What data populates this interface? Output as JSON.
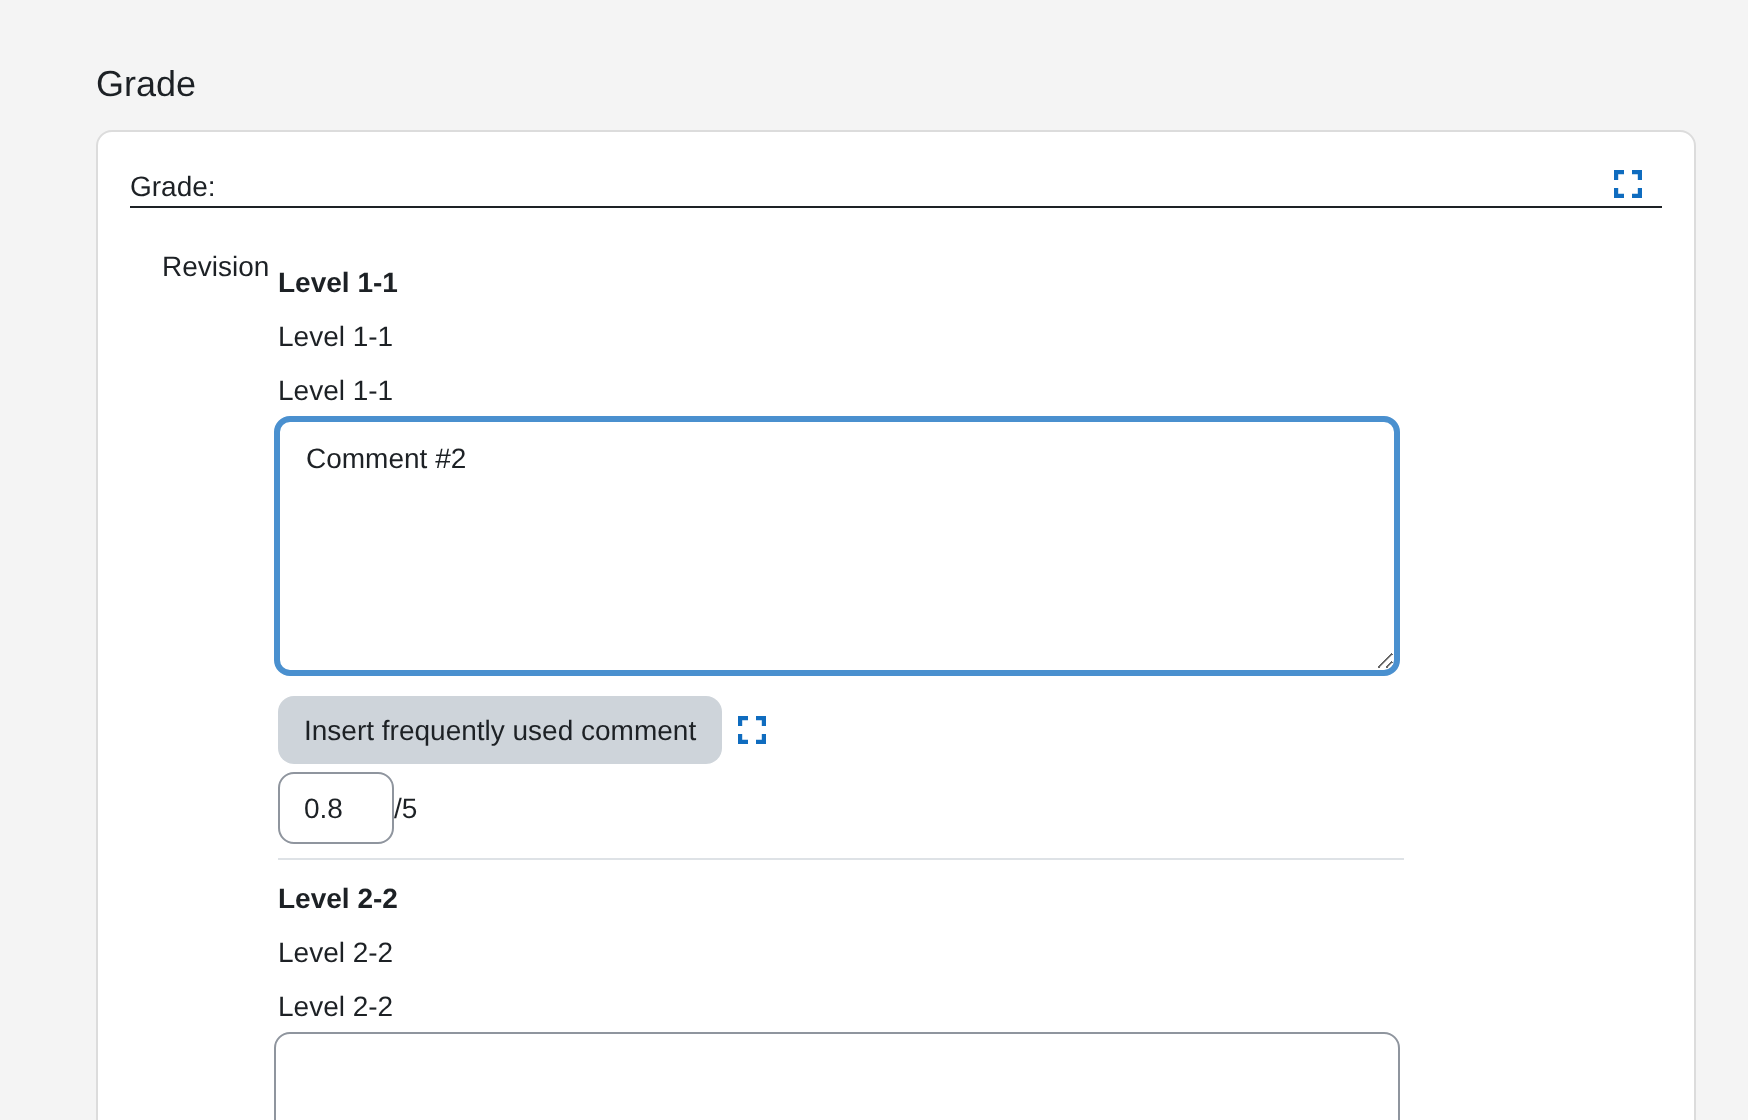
{
  "heading": "Grade",
  "legend": "Grade:",
  "row_label": "Revision",
  "criteria": [
    {
      "title": "Level 1-1",
      "lines": [
        "Level 1-1",
        "Level 1-1"
      ],
      "comment": "Comment #2",
      "focused": true,
      "button": "Insert frequently used comment",
      "score": "0.8",
      "max": "/5"
    },
    {
      "title": "Level 2-2",
      "lines": [
        "Level 2-2",
        "Level 2-2"
      ],
      "focused": false
    }
  ]
}
